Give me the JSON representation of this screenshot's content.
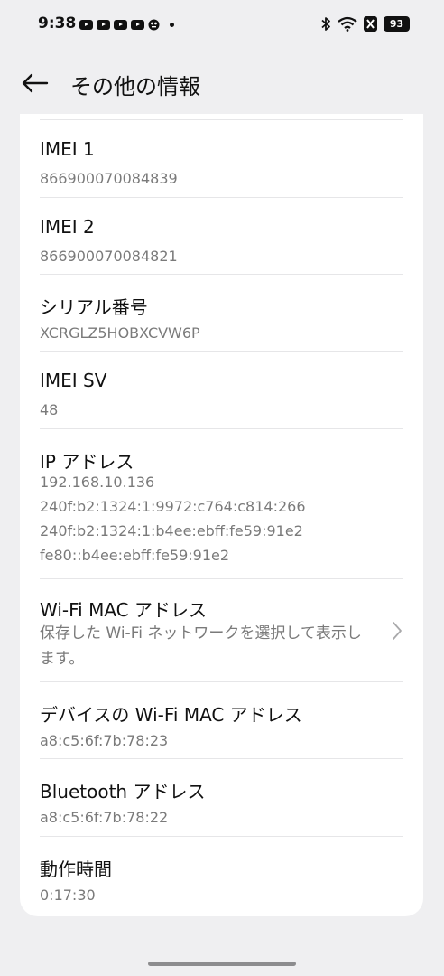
{
  "status_bar": {
    "time": "9:38",
    "battery": "93",
    "icons": [
      "youtube-icon",
      "youtube-icon",
      "youtube-icon",
      "youtube-icon",
      "app-icon",
      "dot-icon",
      "bluetooth-icon",
      "wifi-icon",
      "nfc-icon",
      "battery-icon"
    ]
  },
  "header": {
    "title": "その他の情報",
    "back_icon": "back-arrow-icon"
  },
  "rows": {
    "imei1": {
      "title": "IMEI 1",
      "value": "866900070084839"
    },
    "imei2": {
      "title": "IMEI 2",
      "value": "866900070084821"
    },
    "serial": {
      "title": "シリアル番号",
      "value": "XCRGLZ5HOBXCVW6P"
    },
    "imei_sv": {
      "title": "IMEI SV",
      "value": "48"
    },
    "ip": {
      "title": "IP アドレス",
      "values": [
        "192.168.10.136",
        "240f:b2:1324:1:9972:c764:c814:266",
        "240f:b2:1324:1:b4ee:ebff:fe59:91e2",
        "fe80::b4ee:ebff:fe59:91e2"
      ]
    },
    "wifi_mac": {
      "title": "Wi-Fi MAC アドレス",
      "desc": "保存した Wi-Fi ネットワークを選択して表示します。",
      "chevron_icon": "chevron-right-icon"
    },
    "device_wifi_mac": {
      "title": "デバイスの Wi-Fi MAC アドレス",
      "value": "a8:c5:6f:7b:78:23"
    },
    "bluetooth": {
      "title": "Bluetooth アドレス",
      "value": "a8:c5:6f:7b:78:22"
    },
    "uptime": {
      "title": "動作時間",
      "value": "0:17:30"
    }
  },
  "colors": {
    "background": "#efeff1",
    "card": "#ffffff",
    "title_text": "#111111",
    "secondary_text": "#7a7a7a",
    "divider": "#e6e6e8"
  }
}
